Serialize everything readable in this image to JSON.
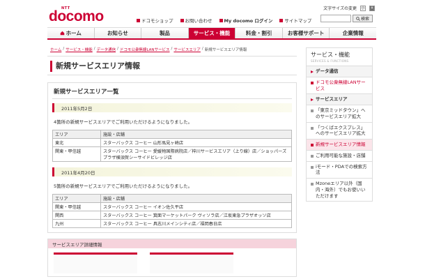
{
  "brand": {
    "ntt": "NTT",
    "name": "docomo"
  },
  "utility": {
    "font_size_label": "文字サイズの変更",
    "size_buttons": [
      "小",
      "大"
    ],
    "links": [
      "ドコモショップ",
      "お問い合わせ",
      "My docomo ログイン",
      "サイトマップ"
    ],
    "search_placeholder": "",
    "search_button": "検索"
  },
  "global_nav": [
    {
      "label": "ホーム",
      "active": false
    },
    {
      "label": "お知らせ",
      "active": false
    },
    {
      "label": "製品",
      "active": false
    },
    {
      "label": "サービス・機能",
      "active": true
    },
    {
      "label": "料金・割引",
      "active": false
    },
    {
      "label": "お客様サポート",
      "active": false
    },
    {
      "label": "企業情報",
      "active": false
    }
  ],
  "breadcrumb": {
    "links": [
      "ホーム",
      "サービス・機能",
      "データ通信",
      "ドコモ公衆無線LANサービス",
      "サービスエリア"
    ],
    "current": "新規サービスエリア情報"
  },
  "page_title": "新規サービスエリア情報",
  "panel_title": "新規サービスエリア一覧",
  "sections": [
    {
      "date": "2011年5月2日",
      "intro": "4箇所の新規サービスエリアでご利用いただけるようになりました。",
      "headers": [
        "エリア",
        "施設・店舗"
      ],
      "rows": [
        {
          "area": "東北",
          "facility": "スターバックス コーヒー 山形馬見ヶ崎店"
        },
        {
          "area": "関東・甲信越",
          "facility": "スターバックス コーヒー 愛媛物国際病院店／梓川サービスエリア（上り線）店／ショッパーズプラザ横須賀シーサイドビレッジ店"
        }
      ]
    },
    {
      "date": "2011年4月20日",
      "intro": "5箇所の新規サービスエリアでご利用いただけるようになりました。",
      "headers": [
        "エリア",
        "施設・店舗"
      ],
      "rows": [
        {
          "area": "関東・甲信越",
          "facility": "スターバックス コーヒー イオン佐久平店"
        },
        {
          "area": "関西",
          "facility": "スターバックス コーヒー 箕面マーケットパーク ヴィソラ店／江坂東急プラザオッソ店"
        },
        {
          "area": "九州",
          "facility": "スターバックス コーヒー 具志川メインシティ店／福岡春日店"
        }
      ]
    }
  ],
  "detail_box_title": "サービスエリア詳細情報",
  "sidebar": {
    "title": "サービス・機能",
    "subtitle": "SERVICES & FUNCTIONS",
    "items": [
      {
        "label": "データ通信",
        "kind": "head"
      },
      {
        "label": "ドコモ公衆無線LANサービス",
        "kind": "link"
      },
      {
        "label": "サービスエリア",
        "kind": "head"
      },
      {
        "label": "「東京ミッドタウン」へのサービスエリア拡大",
        "kind": "sub"
      },
      {
        "label": "「つくばエクスプレス」へのサービスエリア拡大",
        "kind": "sub"
      },
      {
        "label": "新規サービスエリア情報",
        "kind": "current"
      },
      {
        "label": "ご利用可能な施設・店舗",
        "kind": "sub"
      },
      {
        "label": "iモード・PDAでの検索方法",
        "kind": "sub"
      },
      {
        "label": "Mzoneエリア以外（国内・海外）でもお使いいただけます",
        "kind": "sub"
      }
    ]
  }
}
